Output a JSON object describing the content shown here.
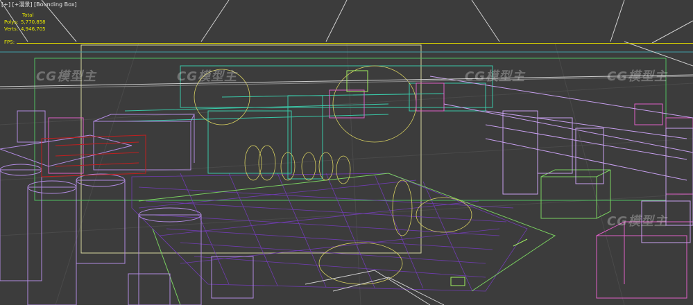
{
  "viewport": {
    "label_parts": [
      "[+]",
      "[+漫景]",
      "[Bounding Box]"
    ],
    "stats": {
      "header": "Total",
      "polys_label": "Polys:",
      "polys_value": "5,770,858",
      "verts_label": "Verts:",
      "verts_value": "4,946,705",
      "fps_label": "FPS:"
    }
  },
  "watermark": "CG模型主",
  "colors": {
    "background": "#3c3c3c",
    "stats_text": "#e8e800",
    "wire_purple": "#b08ae0",
    "wire_violet": "#7a3cc8",
    "wire_pink": "#e060c8",
    "wire_teal": "#3ac8a8",
    "wire_green": "#7ad060",
    "wire_yellow": "#d8d060",
    "wire_white": "#e8e8e8",
    "wire_red": "#c02020"
  }
}
